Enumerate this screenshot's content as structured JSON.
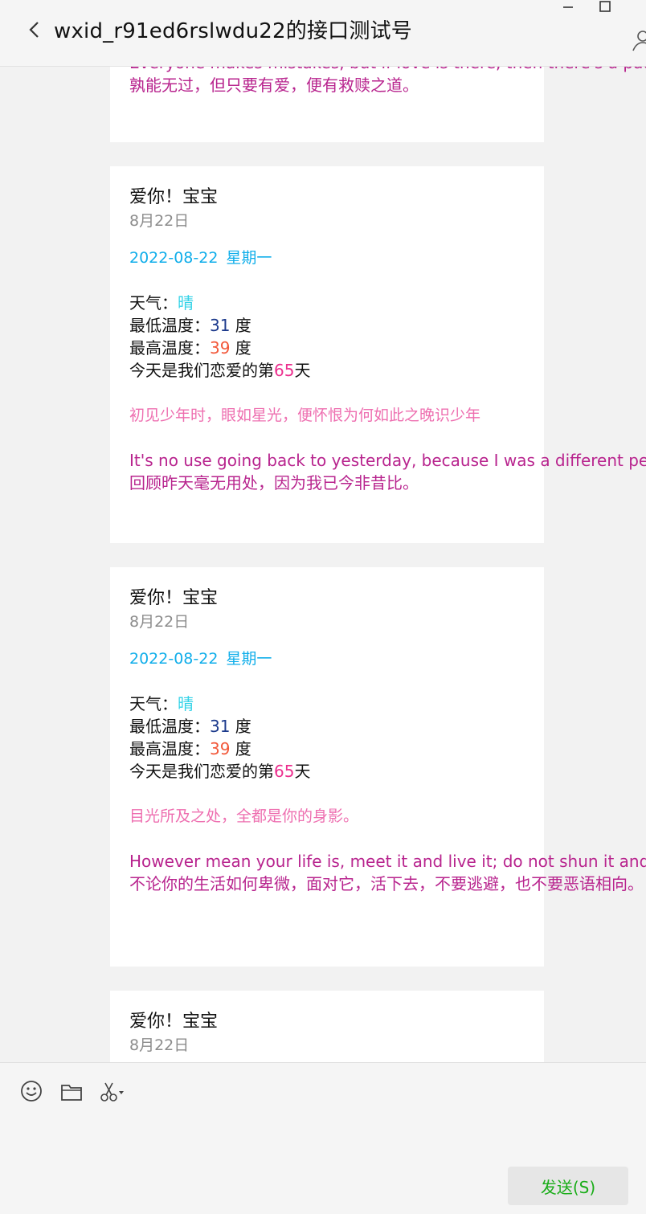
{
  "header": {
    "title": "wxid_r91ed6rslwdu22的接口测试号",
    "back_icon": "chevron-left-icon",
    "window_controls": [
      "minimize-icon",
      "maximize-icon"
    ],
    "profile_icon": "person-icon"
  },
  "messages": [
    {
      "en": "Everyone makes mistakes, but if love is there, then there's a path to redemption.",
      "zh": "孰能无过，但只要有爱，便有救赎之道。"
    },
    {
      "title": "爱你！宝宝",
      "date": "8月22日",
      "ymd": "2022-08-22",
      "weekday": "星期一",
      "weather_label": "天气：",
      "weather": "晴",
      "low_label": "最低温度：",
      "low": "31",
      "high_label": "最高温度：",
      "high": "39",
      "unit": " 度",
      "love_prefix": "今天是我们恋爱的第",
      "love_days": "65",
      "love_suffix": "天",
      "poem": "初见少年时，眼如星光，便怀恨为何如此之晚识少年",
      "en": "It's no use going back to yesterday, because I was a different person then.",
      "zh": "回顾昨天毫无用处，因为我已今非昔比。"
    },
    {
      "title": "爱你！宝宝",
      "date": "8月22日",
      "ymd": "2022-08-22",
      "weekday": "星期一",
      "weather_label": "天气：",
      "weather": "晴",
      "low_label": "最低温度：",
      "low": "31",
      "high_label": "最高温度：",
      "high": "39",
      "unit": " 度",
      "love_prefix": "今天是我们恋爱的第",
      "love_days": "65",
      "love_suffix": "天",
      "poem": "目光所及之处，全都是你的身影。",
      "en": "However mean your life is, meet it and live it; do not shun it and call it hard times.",
      "zh": "不论你的生活如何卑微，面对它，活下去，不要逃避，也不要恶语相向。"
    },
    {
      "title": "爱你！宝宝",
      "date": "8月22日"
    }
  ],
  "toolbar": {
    "icons": [
      "emoji-icon",
      "folder-icon",
      "scissors-icon"
    ],
    "send_label": "发送(S)"
  },
  "colors": {
    "accent_blue": "#10aeea",
    "weather": "#33d2e7",
    "low_temp": "#1c3a8c",
    "high_temp": "#f2583a",
    "days": "#ec2f8e",
    "poem": "#ee6fb0",
    "quote": "#b8248e",
    "send_text": "#1aad19"
  }
}
